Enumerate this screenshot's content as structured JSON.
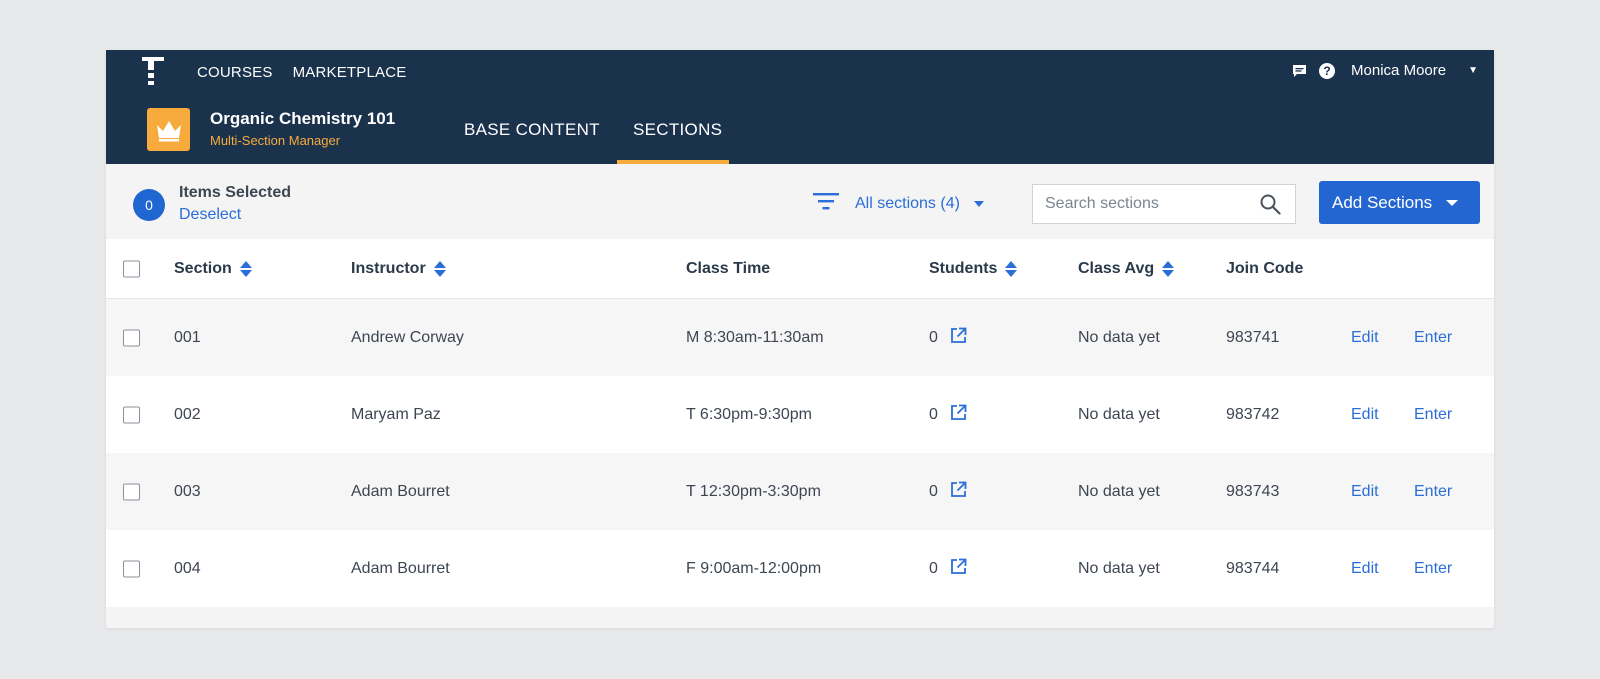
{
  "nav": {
    "links": [
      "COURSES",
      "MARKETPLACE"
    ],
    "user_name": "Monica Moore"
  },
  "course": {
    "title": "Organic Chemistry 101",
    "subtitle": "Multi-Section Manager",
    "tabs": [
      "BASE CONTENT",
      "SECTIONS"
    ],
    "active_tab": "SECTIONS"
  },
  "toolbar": {
    "selected_count": "0",
    "items_selected_label": "Items Selected",
    "deselect_label": "Deselect",
    "filter_label": "All sections (4)",
    "search_placeholder": "Search sections",
    "add_button_label": "Add Sections"
  },
  "table": {
    "headers": {
      "section": "Section",
      "instructor": "Instructor",
      "class_time": "Class Time",
      "students": "Students",
      "class_avg": "Class Avg",
      "join_code": "Join Code"
    },
    "rows": [
      {
        "section": "001",
        "instructor": "Andrew Corway",
        "class_time": "M 8:30am-11:30am",
        "students": "0",
        "class_avg": "No data yet",
        "join_code": "983741",
        "edit": "Edit",
        "enter": "Enter"
      },
      {
        "section": "002",
        "instructor": "Maryam Paz",
        "class_time": "T 6:30pm-9:30pm",
        "students": "0",
        "class_avg": "No data yet",
        "join_code": "983742",
        "edit": "Edit",
        "enter": "Enter"
      },
      {
        "section": "003",
        "instructor": "Adam Bourret",
        "class_time": "T 12:30pm-3:30pm",
        "students": "0",
        "class_avg": "No data yet",
        "join_code": "983743",
        "edit": "Edit",
        "enter": "Enter"
      },
      {
        "section": "004",
        "instructor": "Adam Bourret",
        "class_time": "F 9:00am-12:00pm",
        "students": "0",
        "class_avg": "No data yet",
        "join_code": "983744",
        "edit": "Edit",
        "enter": "Enter"
      }
    ]
  },
  "colors": {
    "header_bg": "#1b324c",
    "accent_orange": "#f6ab3c",
    "link_blue": "#2b6ed8",
    "button_blue": "#2366d1"
  },
  "icons": [
    "app-logo-icon",
    "chat-icon",
    "help-icon",
    "crown-icon",
    "filter-icon",
    "search-icon",
    "sort-icon",
    "external-link-icon"
  ]
}
